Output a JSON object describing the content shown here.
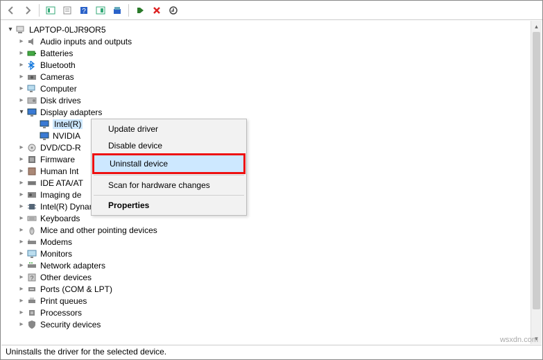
{
  "toolbar": {
    "back": "◄",
    "forward": "►"
  },
  "root": "LAPTOP-0LJR9OR5",
  "categories": [
    {
      "label": "Audio inputs and outputs",
      "state": "closed",
      "icon": "audio"
    },
    {
      "label": "Batteries",
      "state": "closed",
      "icon": "battery"
    },
    {
      "label": "Bluetooth",
      "state": "closed",
      "icon": "bluetooth"
    },
    {
      "label": "Cameras",
      "state": "closed",
      "icon": "camera"
    },
    {
      "label": "Computer",
      "state": "closed",
      "icon": "computer"
    },
    {
      "label": "Disk drives",
      "state": "closed",
      "icon": "disk"
    },
    {
      "label": "Display adapters",
      "state": "open",
      "icon": "display",
      "children": [
        {
          "label": "Intel(R)",
          "selected": true,
          "icon": "display"
        },
        {
          "label": "NVIDIA",
          "icon": "display"
        }
      ]
    },
    {
      "label": "DVD/CD-R",
      "state": "closed",
      "icon": "dvd"
    },
    {
      "label": "Firmware",
      "state": "closed",
      "icon": "firmware"
    },
    {
      "label": "Human Int",
      "state": "closed",
      "icon": "hid"
    },
    {
      "label": "IDE ATA/AT",
      "state": "closed",
      "icon": "ide"
    },
    {
      "label": "Imaging de",
      "state": "closed",
      "icon": "imaging"
    },
    {
      "label": "Intel(R) Dynamic Platform and Thermal Framework",
      "state": "closed",
      "icon": "chip"
    },
    {
      "label": "Keyboards",
      "state": "closed",
      "icon": "keyboard"
    },
    {
      "label": "Mice and other pointing devices",
      "state": "closed",
      "icon": "mouse"
    },
    {
      "label": "Modems",
      "state": "closed",
      "icon": "modem"
    },
    {
      "label": "Monitors",
      "state": "closed",
      "icon": "monitor"
    },
    {
      "label": "Network adapters",
      "state": "closed",
      "icon": "network"
    },
    {
      "label": "Other devices",
      "state": "closed",
      "icon": "other"
    },
    {
      "label": "Ports (COM & LPT)",
      "state": "closed",
      "icon": "port"
    },
    {
      "label": "Print queues",
      "state": "closed",
      "icon": "printer"
    },
    {
      "label": "Processors",
      "state": "closed",
      "icon": "cpu"
    },
    {
      "label": "Security devices",
      "state": "closed",
      "icon": "security"
    }
  ],
  "context_menu": {
    "update": "Update driver",
    "disable": "Disable device",
    "uninstall": "Uninstall device",
    "scan": "Scan for hardware changes",
    "properties": "Properties"
  },
  "status": "Uninstalls the driver for the selected device.",
  "watermark": "wsxdn.com"
}
